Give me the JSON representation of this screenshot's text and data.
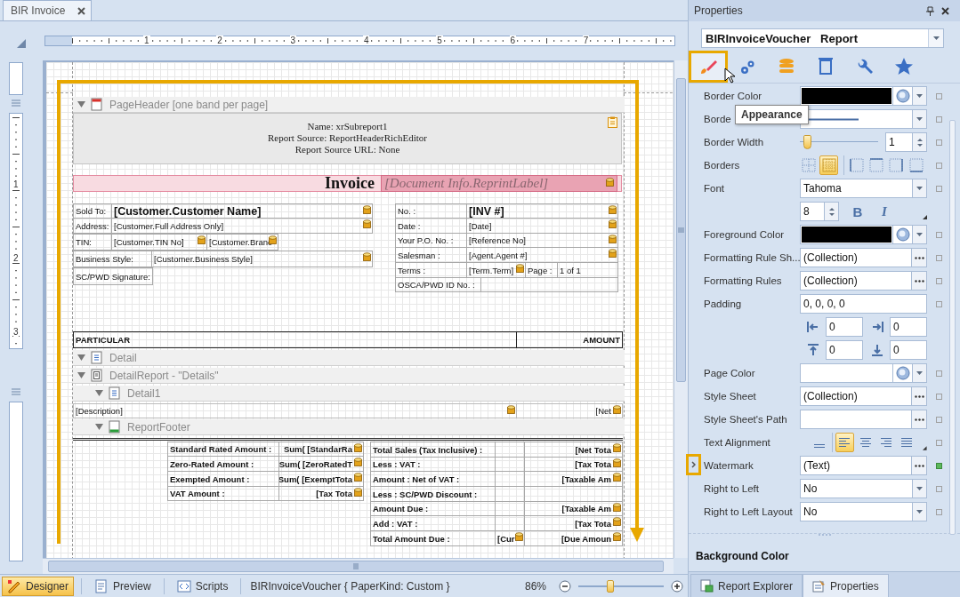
{
  "document_tab": {
    "title": "BIR Invoice"
  },
  "rulers": {
    "horizontal": [
      "1",
      "2",
      "3",
      "4",
      "5",
      "6",
      "7"
    ],
    "vertical": [
      "1",
      "2",
      "3"
    ]
  },
  "report": {
    "bands": [
      {
        "kind": "page_header",
        "label": "PageHeader [one band per page]",
        "expanded": true
      },
      {
        "kind": "detail",
        "label": "Detail",
        "expanded": true
      },
      {
        "kind": "detail_report",
        "label": "DetailReport - \"Details\"",
        "expanded": true,
        "children": [
          {
            "kind": "detail",
            "label": "Detail1",
            "expanded": true
          },
          {
            "kind": "report_footer",
            "label": "ReportFooter",
            "expanded": true
          }
        ]
      }
    ],
    "subreport": [
      "Name: xrSubreport1",
      "Report Source: ReportHeaderRichEditor",
      "Report Source URL: None"
    ],
    "title": "Invoice",
    "reprint_label": {
      "text": "[Document Info.ReprintLabel]",
      "bound": true
    },
    "customer_table": [
      [
        {
          "text": "Sold To:",
          "kind": "label",
          "bound": false
        },
        {
          "text": "[Customer.Customer Name]",
          "kind": "large",
          "bound": true
        }
      ],
      [
        {
          "text": "Address:",
          "kind": "label",
          "bound": false
        },
        {
          "text": "[Customer.Full Address Only]",
          "kind": "field",
          "bound": true
        }
      ],
      [
        {
          "text": "TIN:",
          "kind": "label",
          "bound": false
        },
        {
          "text": "[Customer.TIN No]",
          "kind": "field",
          "bound": true
        },
        {
          "text": "[Customer.Branc",
          "kind": "field",
          "bound": true
        }
      ],
      [
        {
          "text": "Business Style:",
          "kind": "label",
          "bound": false
        },
        {
          "text": "[Customer.Business Style]",
          "kind": "field",
          "bound": true
        }
      ],
      [
        {
          "text": "SC/PWD Signature:",
          "kind": "label",
          "bound": false
        }
      ]
    ],
    "invoice_table": [
      [
        {
          "text": "No. :",
          "kind": "label",
          "bound": false
        },
        {
          "text": "[INV #]",
          "kind": "large",
          "bound": true
        }
      ],
      [
        {
          "text": "Date :",
          "kind": "label",
          "bound": false
        },
        {
          "text": "[Date]",
          "kind": "field",
          "bound": true
        }
      ],
      [
        {
          "text": "Your P.O. No. :",
          "kind": "label",
          "bound": false
        },
        {
          "text": "[Reference No]",
          "kind": "field",
          "bound": true
        }
      ],
      [
        {
          "text": "Salesman :",
          "kind": "label",
          "bound": false
        },
        {
          "text": "[Agent.Agent #]",
          "kind": "field",
          "bound": true
        }
      ],
      [
        {
          "text": "Terms :",
          "kind": "label",
          "bound": false
        },
        {
          "text": "[Term.Term]",
          "kind": "field",
          "bound": true
        },
        {
          "text": "Page :",
          "kind": "label",
          "bound": false
        },
        {
          "text": "1 of 1",
          "kind": "field",
          "bound": false
        }
      ],
      [
        {
          "text": "OSCA/PWD ID No. :",
          "kind": "label",
          "bound": false
        },
        {
          "kind": "field",
          "bound": false
        }
      ]
    ],
    "column_headers": [
      {
        "text": "PARTICULAR",
        "bound": false
      },
      {
        "text": "AMOUNT",
        "bound": false
      }
    ],
    "detail_row": [
      {
        "text": "[Description]",
        "bound": true
      },
      {
        "text": "[Net",
        "bound": true
      }
    ],
    "vat_table": [
      [
        {
          "text": "Standard Rated Amount :",
          "bound": false
        },
        {
          "text": "Sum( [StandarRa",
          "bound": true
        }
      ],
      [
        {
          "text": "Zero-Rated Amount :",
          "bound": false
        },
        {
          "text": "Sum( [ZeroRatedT",
          "bound": true
        }
      ],
      [
        {
          "text": "Exempted Amount :",
          "bound": false
        },
        {
          "text": "Sum( [ExemptTota",
          "bound": true
        }
      ],
      [
        {
          "text": "VAT Amount :",
          "bound": false
        },
        {
          "text": "[Tax Tota",
          "bound": true
        }
      ]
    ],
    "totals_table": [
      [
        {
          "text": "Total Sales (Tax Inclusive) :",
          "bound": false
        },
        {
          "bound": false
        },
        {
          "text": "[Net Tota",
          "bound": true
        }
      ],
      [
        {
          "text": "Less : VAT :",
          "bound": false
        },
        {
          "bound": false
        },
        {
          "text": "[Tax Tota",
          "bound": true
        }
      ],
      [
        {
          "text": "Amount : Net of VAT :",
          "bound": false
        },
        {
          "bound": false
        },
        {
          "text": "[Taxable Am",
          "bound": true
        }
      ],
      [
        {
          "text": "Less : SC/PWD Discount :",
          "bound": false
        },
        {
          "bound": false
        },
        {
          "bound": false
        }
      ],
      [
        {
          "text": "Amount Due :",
          "bound": false
        },
        {
          "bound": false
        },
        {
          "text": "[Taxable Am",
          "bound": true
        }
      ],
      [
        {
          "text": "Add : VAT :",
          "bound": false
        },
        {
          "bound": false
        },
        {
          "text": "[Tax Tota",
          "bound": true
        }
      ],
      [
        {
          "text": "Total Amount Due :",
          "bound": false
        },
        {
          "text": "[Cur",
          "bound": true
        },
        {
          "text": "[Due Amoun",
          "bound": true
        }
      ]
    ]
  },
  "status_bar": {
    "views": [
      {
        "kind": "designer",
        "label": "Designer",
        "selected": true
      },
      {
        "kind": "preview",
        "label": "Preview",
        "selected": false
      },
      {
        "kind": "scripts",
        "label": "Scripts",
        "selected": false
      }
    ],
    "info": "BIRInvoiceVoucher { PaperKind: Custom }",
    "zoom": {
      "reading": "86%",
      "level": 0.37
    }
  },
  "properties": {
    "title": "Properties",
    "object": "BIRInvoiceVoucher   Report",
    "category_tabs": [
      {
        "kind": "appearance",
        "selected": true
      },
      {
        "kind": "behavior",
        "selected": false
      },
      {
        "kind": "data",
        "selected": false
      },
      {
        "kind": "layout",
        "selected": false
      },
      {
        "kind": "tools",
        "selected": false
      },
      {
        "kind": "favorites",
        "selected": false
      }
    ],
    "tooltip": "Appearance",
    "rows": [
      {
        "kind": "color",
        "label": "Border Color",
        "color": "#000000",
        "modified": false
      },
      {
        "kind": "line",
        "label": "Borde",
        "modified": false
      },
      {
        "kind": "slider",
        "label": "Border Width",
        "level": 0.05,
        "value": "1",
        "modified": false
      },
      {
        "kind": "borders",
        "label": "Borders",
        "options": [
          {
            "selected": false
          },
          {
            "selected": true
          },
          {
            "selected": false
          },
          {
            "selected": false
          },
          {
            "selected": false
          },
          {
            "selected": false
          }
        ],
        "modified": false
      },
      {
        "kind": "dropdown",
        "label": "Font",
        "value": "Tahoma",
        "modified": false
      },
      {
        "kind": "font_size",
        "value": "8",
        "bold": "B",
        "italic": "I"
      },
      {
        "kind": "color",
        "label": "Foreground Color",
        "color": "#000000",
        "modified": false
      },
      {
        "kind": "collection",
        "label": "Formatting Rule Sh...",
        "value": "(Collection)",
        "modified": false
      },
      {
        "kind": "collection",
        "label": "Formatting Rules",
        "value": "(Collection)",
        "modified": false
      },
      {
        "kind": "text",
        "label": "Padding",
        "value": "0, 0, 0, 0",
        "modified": false
      },
      {
        "kind": "sides",
        "values": [
          "0",
          "0"
        ]
      },
      {
        "kind": "sides",
        "values": [
          "0",
          "0"
        ]
      },
      {
        "kind": "color",
        "label": "Page Color",
        "modified": false
      },
      {
        "kind": "collection",
        "label": "Style Sheet",
        "value": "(Collection)",
        "modified": false
      },
      {
        "kind": "collection",
        "label": "Style Sheet's Path",
        "modified": false
      },
      {
        "kind": "alignment",
        "label": "Text Alignment",
        "options": [
          {
            "selected": false
          },
          {
            "selected": true
          },
          {
            "selected": false
          },
          {
            "selected": false
          },
          {
            "selected": false
          }
        ],
        "modified": false
      },
      {
        "kind": "collection",
        "label": "Watermark",
        "value": "(Text)",
        "modified": true,
        "expandable": true
      },
      {
        "kind": "dropdown",
        "label": "Right to Left",
        "value": "No",
        "modified": false
      },
      {
        "kind": "dropdown",
        "label": "Right to Left Layout",
        "value": "No",
        "modified": false
      }
    ],
    "description": "Background Color",
    "bottom_tabs": [
      {
        "kind": "explorer",
        "label": "Report Explorer",
        "selected": false
      },
      {
        "kind": "properties",
        "label": "Properties",
        "selected": true
      }
    ]
  }
}
